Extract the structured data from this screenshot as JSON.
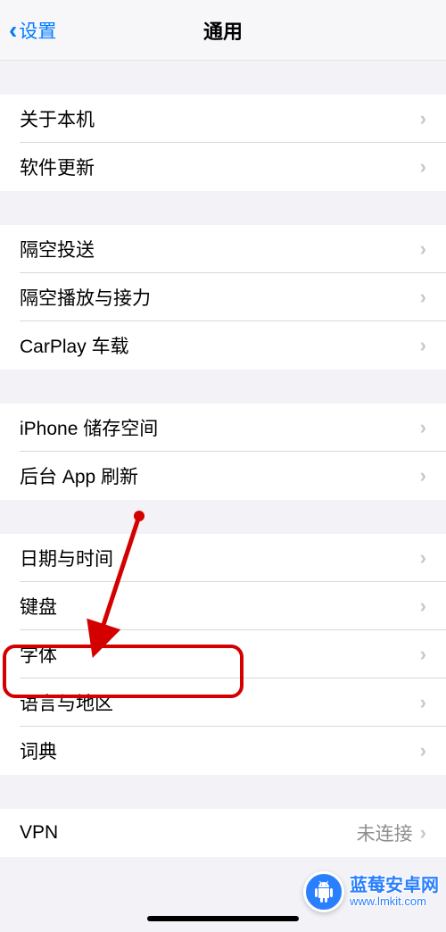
{
  "nav": {
    "back_label": "设置",
    "title": "通用"
  },
  "groups": [
    {
      "rows": [
        {
          "label": "关于本机"
        },
        {
          "label": "软件更新"
        }
      ]
    },
    {
      "rows": [
        {
          "label": "隔空投送"
        },
        {
          "label": "隔空播放与接力"
        },
        {
          "label": "CarPlay 车载"
        }
      ]
    },
    {
      "rows": [
        {
          "label": "iPhone 储存空间"
        },
        {
          "label": "后台 App 刷新"
        }
      ]
    },
    {
      "rows": [
        {
          "label": "日期与时间"
        },
        {
          "label": "键盘"
        },
        {
          "label": "字体"
        },
        {
          "label": "语言与地区"
        },
        {
          "label": "词典"
        }
      ]
    },
    {
      "rows": [
        {
          "label": "VPN",
          "detail": "未连接"
        }
      ]
    }
  ],
  "watermark": {
    "title": "蓝莓安卓网",
    "url": "www.lmkit.com"
  },
  "annotation": {
    "highlight_target": "字体"
  }
}
